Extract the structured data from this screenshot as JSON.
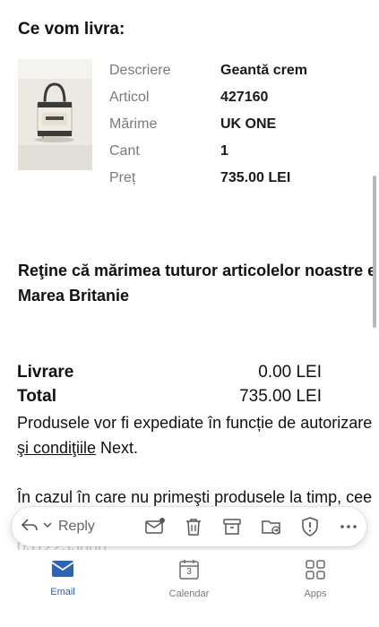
{
  "order": {
    "section_title": "Ce vom livra:",
    "details": [
      {
        "label": "Descriere",
        "value": "Geantă crem"
      },
      {
        "label": "Articol",
        "value": "427160"
      },
      {
        "label": "Mărime",
        "value": "UK ONE"
      },
      {
        "label": "Cant",
        "value": "1"
      },
      {
        "label": "Preț",
        "value": "735.00 LEI"
      }
    ]
  },
  "notice": {
    "line1": "Reţine că mărimea tuturor articolelor noastre e",
    "line2": "Marea Britanie"
  },
  "summary": {
    "delivery_label": "Livrare",
    "delivery_value": "0.00 LEI",
    "total_label": "Total",
    "total_value": "735.00 LEI"
  },
  "body": {
    "shipping_line1": "Produsele vor fi expediate în funcție de autorizare",
    "shipping_link": "şi condiţiile",
    "shipping_after_link": " Next.",
    "late_line": "În cazul în care nu primeşti produsele la timp, cee",
    "ghost_text": "0312233080."
  },
  "toolbar": {
    "reply_label": "Reply"
  },
  "tabs": [
    {
      "label": "Email",
      "badge": ""
    },
    {
      "label": "Calendar",
      "badge": "3"
    },
    {
      "label": "Apps",
      "badge": ""
    }
  ],
  "colors": {
    "accent": "#2b63b8",
    "muted_label": "#7a7a7a"
  }
}
